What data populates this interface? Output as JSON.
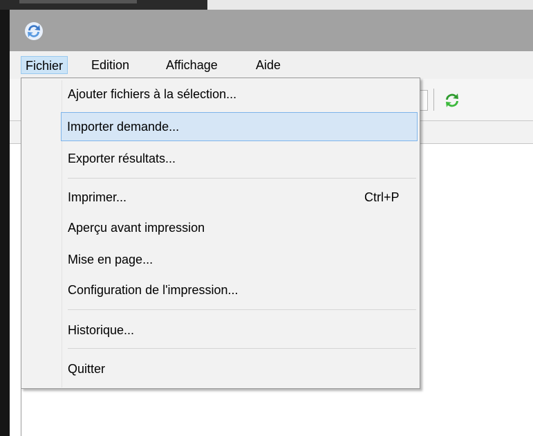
{
  "menubar": {
    "items": [
      {
        "label": "Fichier"
      },
      {
        "label": "Edition"
      },
      {
        "label": "Affichage"
      },
      {
        "label": "Aide"
      }
    ]
  },
  "file_menu": {
    "items": [
      {
        "label": "Ajouter fichiers à la sélection..."
      },
      {
        "label": "Importer demande..."
      },
      {
        "label": "Exporter résultats..."
      },
      {
        "label": "Imprimer...",
        "shortcut": "Ctrl+P"
      },
      {
        "label": "Aperçu avant impression"
      },
      {
        "label": "Mise en page..."
      },
      {
        "label": "Configuration de l'impression..."
      },
      {
        "label": "Historique..."
      },
      {
        "label": "Quitter"
      }
    ]
  },
  "colors": {
    "menu_highlight": "#d6e6f6",
    "menu_highlight_border": "#7eb4ea",
    "refresh_green": "#2e9b2e",
    "app_icon_blue": "#3a78c8"
  },
  "icons": {
    "app": "app-refresh-icon",
    "toolbar_refresh": "refresh-icon"
  }
}
